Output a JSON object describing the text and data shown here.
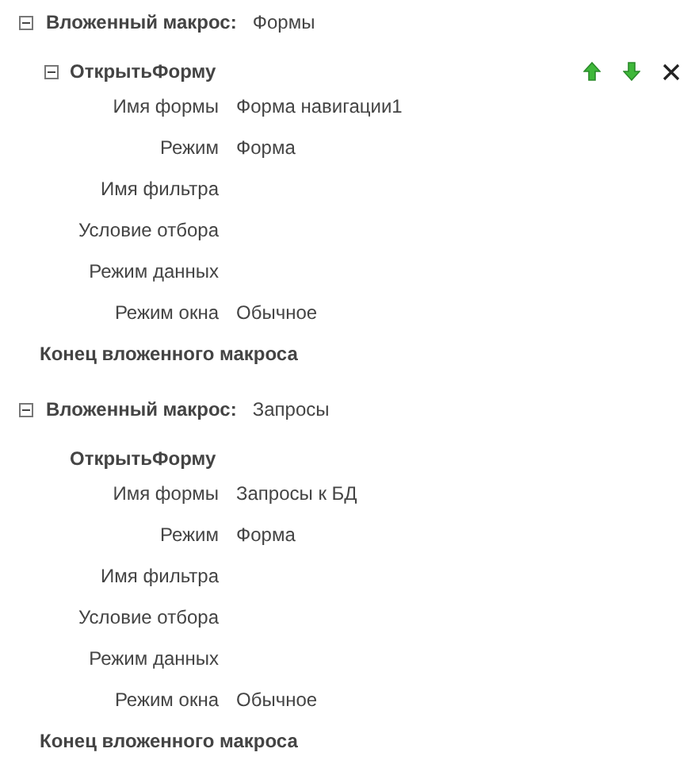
{
  "macros": [
    {
      "label": "Вложенный макрос:",
      "name": "Формы",
      "expanded": true,
      "actions": [
        {
          "name": "ОткрытьФорму",
          "selected": true,
          "params": [
            {
              "label": "Имя формы",
              "value": "Форма навигации1"
            },
            {
              "label": "Режим",
              "value": "Форма"
            },
            {
              "label": "Имя фильтра"
            },
            {
              "label": "Условие отбора"
            },
            {
              "label": "Режим данных"
            },
            {
              "label": "Режим окна",
              "value": "Обычное"
            }
          ]
        }
      ],
      "end": "Конец вложенного макроса"
    },
    {
      "label": "Вложенный макрос:",
      "name": "Запросы",
      "expanded": true,
      "actions": [
        {
          "name": "ОткрытьФорму",
          "selected": false,
          "params": [
            {
              "label": "Имя формы",
              "value": "Запросы к БД"
            },
            {
              "label": "Режим",
              "value": "Форма"
            },
            {
              "label": "Имя фильтра"
            },
            {
              "label": "Условие отбора"
            },
            {
              "label": "Режим данных"
            },
            {
              "label": "Режим окна",
              "value": "Обычное"
            }
          ]
        }
      ],
      "end": "Конец вложенного макроса"
    }
  ]
}
